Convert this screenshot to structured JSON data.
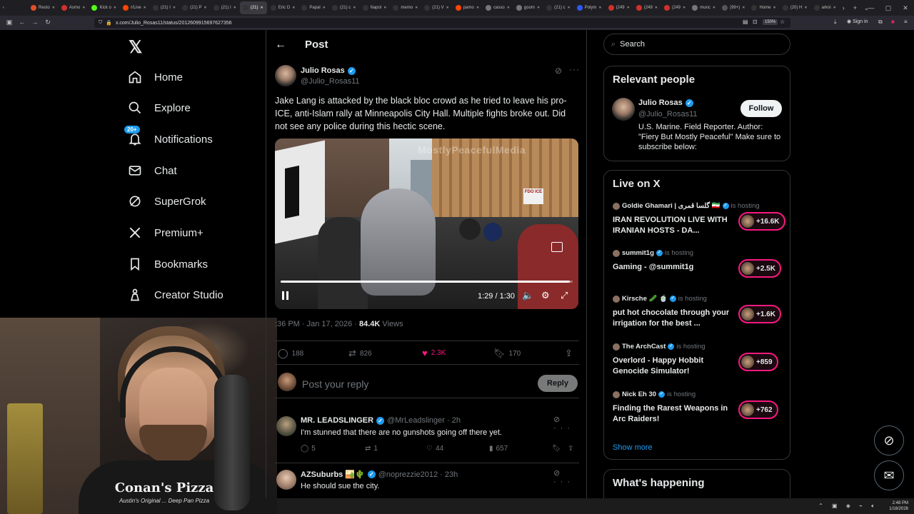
{
  "browser": {
    "tabs": [
      {
        "label": "Resto",
        "color": "#e34f26"
      },
      {
        "label": "Asmo",
        "color": "#d0312d"
      },
      {
        "label": "Kick o",
        "color": "#53fc18"
      },
      {
        "label": "r/Live",
        "color": "#ff4500"
      },
      {
        "label": "(21) I",
        "color": "#333"
      },
      {
        "label": "(21) P",
        "color": "#333"
      },
      {
        "label": "(21) I",
        "color": "#333"
      },
      {
        "label": "(21)",
        "color": "#333",
        "active": true
      },
      {
        "label": "Eric D",
        "color": "#333"
      },
      {
        "label": "Papal",
        "color": "#333"
      },
      {
        "label": "(21) c",
        "color": "#333"
      },
      {
        "label": "Napol",
        "color": "#333"
      },
      {
        "label": "memo",
        "color": "#333"
      },
      {
        "label": "(21) V",
        "color": "#333"
      },
      {
        "label": "pamo",
        "color": "#ff4500"
      },
      {
        "label": "casso",
        "color": "#777"
      },
      {
        "label": "goom",
        "color": "#777"
      },
      {
        "label": "(21) c",
        "color": "#333"
      },
      {
        "label": "Polym",
        "color": "#2d59f5"
      },
      {
        "label": "(249",
        "color": "#d0312d"
      },
      {
        "label": "(249",
        "color": "#d0312d"
      },
      {
        "label": "(249",
        "color": "#d0312d"
      },
      {
        "label": "munc",
        "color": "#777"
      },
      {
        "label": "(99+)",
        "color": "#555"
      },
      {
        "label": "Home",
        "color": "#333"
      },
      {
        "label": "(20) H",
        "color": "#333"
      },
      {
        "label": "arkni",
        "color": "#333"
      }
    ],
    "url": "x.com/Julio_Rosas11/status/2012609915697627356",
    "zoom": "150%",
    "signin": "Sign in"
  },
  "nav": {
    "items": [
      {
        "label": "Home",
        "icon": "home-icon"
      },
      {
        "label": "Explore",
        "icon": "search-icon"
      },
      {
        "label": "Notifications",
        "icon": "bell-icon",
        "badge": "20+"
      },
      {
        "label": "Chat",
        "icon": "mail-icon"
      },
      {
        "label": "SuperGrok",
        "icon": "grok-icon"
      },
      {
        "label": "Premium+",
        "icon": "x-icon"
      },
      {
        "label": "Bookmarks",
        "icon": "bookmark-icon"
      },
      {
        "label": "Creator Studio",
        "icon": "creator-icon"
      }
    ]
  },
  "webcam": {
    "shirt_logo": "Conan's Pizza",
    "shirt_sub": "Austin's Original ... Deep Pan Pizza"
  },
  "post": {
    "header_title": "Post",
    "author_name": "Julio Rosas",
    "author_handle": "@Julio_Rosas11",
    "text": "Jake Lang is attacked by the black bloc crowd as he tried to leave his pro-ICE, anti-Islam rally at Minneapolis City Hall. Multiple fights broke out. Did not see any police during this hectic scene.",
    "video": {
      "watermark": "MostlyPeacefulMedia",
      "time": "1:29 / 1:30",
      "progress": 0.989,
      "sign_text": "FDO ICE"
    },
    "meta_time": ":36 PM · Jan 17, 2026 · ",
    "views_count": "84.4K",
    "views_label": " Views",
    "stats": {
      "replies": "188",
      "reposts": "826",
      "likes": "2.3K",
      "bookmarks": "170"
    },
    "reply_placeholder": "Post your reply",
    "reply_button": "Reply"
  },
  "replies": [
    {
      "name": "MR. LEADSLINGER",
      "handle": "@MrLeadslinger · 2h",
      "text": "I'm stunned that there are no gunshots going off there yet.",
      "replies": "5",
      "reposts": "1",
      "likes": "44",
      "views": "657"
    },
    {
      "name": "AZSuburbs 🏜️🌵",
      "handle": "@noprezzie2012 · 23h",
      "text": "He should sue the city."
    }
  ],
  "sidebar": {
    "search_placeholder": "Search",
    "relevant_title": "Relevant people",
    "relevant": {
      "name": "Julio Rosas",
      "handle": "@Julio_Rosas11",
      "bio": "U.S. Marine. Field Reporter. Author: \"Fiery But Mostly Peaceful\" Make sure to subscribe below:",
      "follow": "Follow"
    },
    "live_title": "Live on X",
    "live": [
      {
        "host": "Goldie Ghamari | گلسا قمری 🇮🇷",
        "status": "is hosting",
        "title": "IRAN REVOLUTION LIVE WITH IRANIAN HOSTS - DA...",
        "count": "+16.6K"
      },
      {
        "host": "summit1g",
        "status": "is hosting",
        "title": "Gaming - @summit1g",
        "count": "+2.5K"
      },
      {
        "host": "Kirsche 🥒 🍵",
        "status": "is hosting",
        "title": "put hot chocolate through your irrigation for the best ...",
        "count": "+1.6K"
      },
      {
        "host": "The ArchCast",
        "status": "is hosting",
        "title": "Overlord - Happy Hobbit Genocide Simulator!",
        "count": "+859"
      },
      {
        "host": "Nick Eh 30",
        "status": "is hosting",
        "title": "Finding the Rarest Weapons in Arc Raiders!",
        "count": "+762"
      }
    ],
    "show_more": "Show more",
    "happening_title": "What's happening"
  },
  "taskbar": {
    "time": "2:48 PM",
    "date": "1/18/2026"
  }
}
